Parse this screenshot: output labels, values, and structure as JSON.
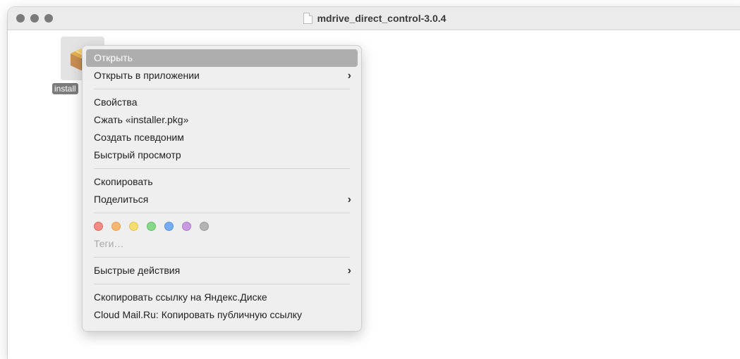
{
  "window": {
    "title": "mdrive_direct_control-3.0.4",
    "controls": [
      {
        "name": "close",
        "color": "#7a7a7a"
      },
      {
        "name": "minimize",
        "color": "#7a7a7a"
      },
      {
        "name": "zoom",
        "color": "#7a7a7a"
      }
    ]
  },
  "file": {
    "label": "install",
    "icon": "package-icon"
  },
  "menu": {
    "open": "Открыть",
    "open_with": "Открыть в приложении",
    "properties": "Свойства",
    "compress": "Сжать «installer.pkg»",
    "make_alias": "Создать псевдоним",
    "quick_look": "Быстрый просмотр",
    "copy": "Скопировать",
    "share": "Поделиться",
    "tags_placeholder": "Теги…",
    "quick_actions": "Быстрые действия",
    "yandex_link": "Скопировать ссылку на Яндекс.Диске",
    "cloud_mail_link": "Cloud Mail.Ru: Копировать публичную ссылку",
    "submenu_glyph": "›",
    "tag_colors": [
      {
        "name": "red",
        "fill": "#f28b84",
        "stroke": "#e06b63"
      },
      {
        "name": "orange",
        "fill": "#f6b773",
        "stroke": "#e89e52"
      },
      {
        "name": "yellow",
        "fill": "#f6dd73",
        "stroke": "#e3c64e"
      },
      {
        "name": "green",
        "fill": "#86d98a",
        "stroke": "#63c168"
      },
      {
        "name": "blue",
        "fill": "#77aef2",
        "stroke": "#5592e0"
      },
      {
        "name": "purple",
        "fill": "#c79be0",
        "stroke": "#ad7bcc"
      },
      {
        "name": "gray",
        "fill": "#b4b4b4",
        "stroke": "#9a9a9a"
      }
    ]
  }
}
